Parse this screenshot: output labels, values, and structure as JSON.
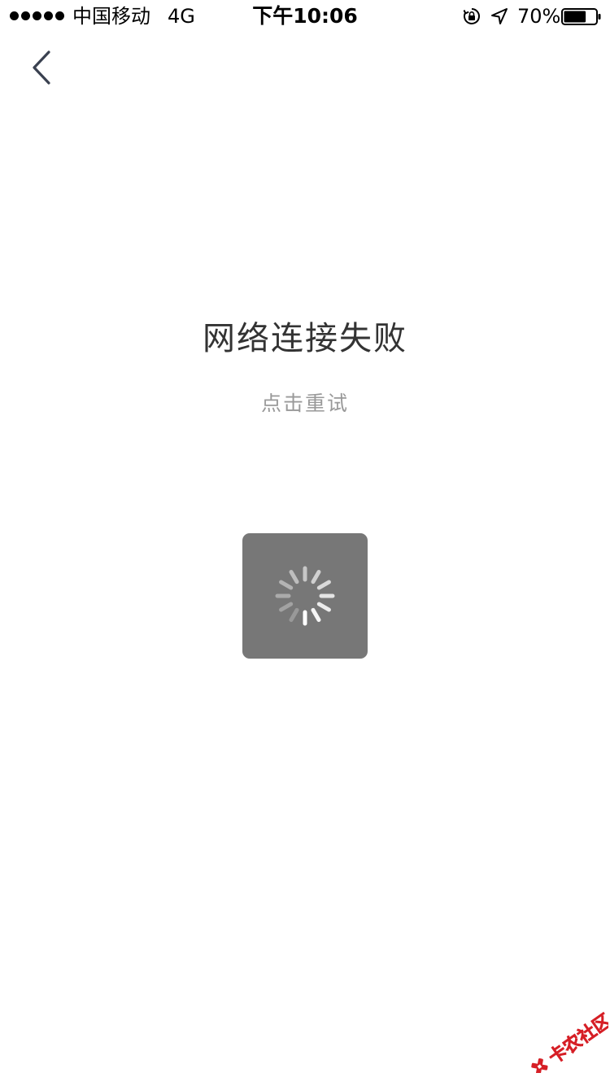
{
  "status_bar": {
    "carrier": "中国移动",
    "network": "4G",
    "time": "下午10:06",
    "battery_percent": "70%",
    "battery_level": 0.7,
    "icons": [
      "signal-dots-icon",
      "orientation-lock-icon",
      "location-arrow-icon",
      "battery-icon"
    ]
  },
  "nav": {
    "back_icon": "chevron-left-icon"
  },
  "error": {
    "title": "网络连接失败",
    "retry_label": "点击重试"
  },
  "loading": {
    "icon": "spinner-icon"
  },
  "watermark": {
    "text": "卡农社区"
  },
  "colors": {
    "title": "#333333",
    "retry": "#999999",
    "hud_background": "#777777",
    "back_icon": "#3a4150",
    "watermark": "#d61f26"
  }
}
